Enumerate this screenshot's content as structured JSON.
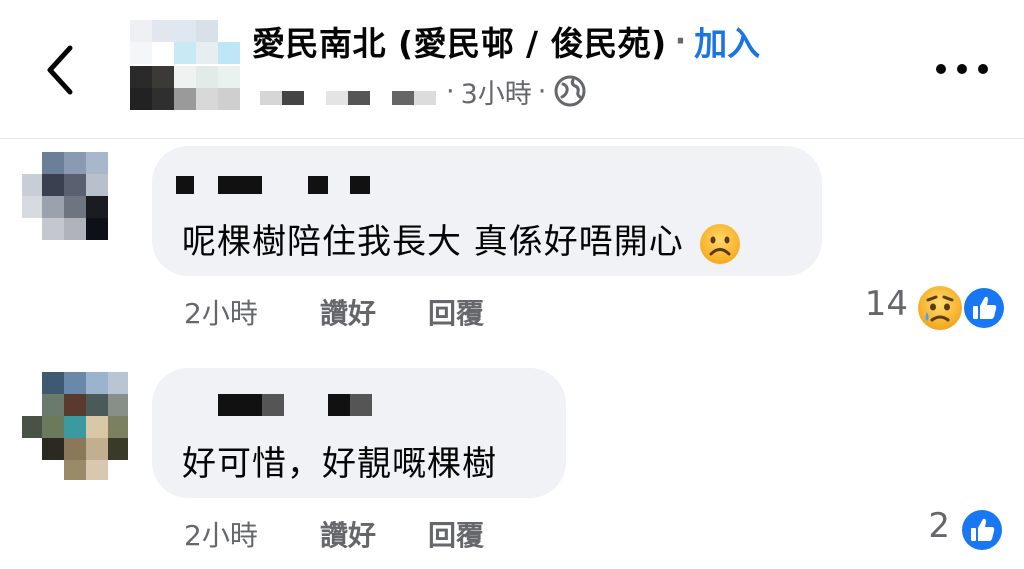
{
  "header": {
    "group_name": "愛民南北 (愛民邨 / 俊民苑)",
    "separator": "·",
    "join_label": "加入",
    "post_time": "3小時",
    "meta_dot": "·",
    "audience_icon": "globe-icon",
    "back_icon": "chevron-left-icon",
    "more_icon": "more-horizontal-icon"
  },
  "comments": [
    {
      "author": "",
      "text": "呢棵樹陪住我長大 真係好唔開心",
      "emoji": "frowning-face-icon",
      "time": "2小時",
      "like_label": "讚好",
      "reply_label": "回覆",
      "reaction_count": "14",
      "reactions": [
        "sad-reaction-icon",
        "like-reaction-icon"
      ]
    },
    {
      "author": "",
      "text": "好可惜，好靚嘅棵樹",
      "time": "2小時",
      "like_label": "讚好",
      "reply_label": "回覆",
      "reaction_count": "2",
      "reactions": [
        "like-reaction-icon"
      ]
    }
  ],
  "colors": {
    "accent": "#1b74e4",
    "bubble": "#f0f2f5",
    "secondary_text": "#65676b"
  }
}
